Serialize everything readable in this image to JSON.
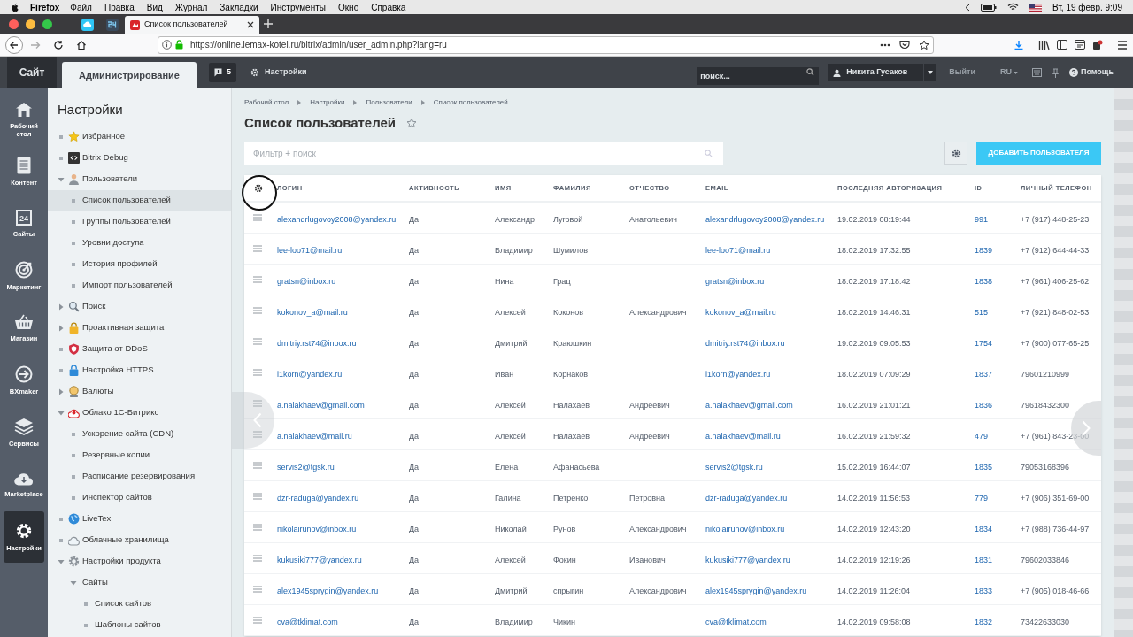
{
  "menubar": {
    "app": "Firefox",
    "menus": [
      "Файл",
      "Правка",
      "Вид",
      "Журнал",
      "Закладки",
      "Инструменты",
      "Окно",
      "Справка"
    ],
    "clock": "Вт, 19 февр. 9:09"
  },
  "browser": {
    "tabs": [
      {
        "kind": "pinned",
        "selected": false
      },
      {
        "kind": "pinned",
        "selected": false
      },
      {
        "kind": "page",
        "title": "Список пользователей",
        "selected": true
      }
    ],
    "url": "https://online.lemax-kotel.ru/bitrix/admin/user_admin.php?lang=ru"
  },
  "admin_bar": {
    "site_button": "Сайт",
    "admin_tab": "Администрирование",
    "notifications": "5",
    "settings": "Настройки",
    "search": {
      "placeholder": "поиск..."
    },
    "user": "Никита Гусаков",
    "logout": "Выйти",
    "language": "RU",
    "help": "Помощь"
  },
  "nav": [
    {
      "label": "Рабочий стол",
      "selected": false
    },
    {
      "label": "Контент",
      "selected": false
    },
    {
      "label": "Сайты",
      "icon_text": "24",
      "selected": false
    },
    {
      "label": "Маркетинг",
      "selected": false
    },
    {
      "label": "Магазин",
      "selected": false
    },
    {
      "label": "BXmaker",
      "selected": false
    },
    {
      "label": "Сервисы",
      "selected": false
    },
    {
      "label": "Marketplace",
      "selected": false
    },
    {
      "label": "Настройки",
      "selected": true
    }
  ],
  "sidebar": {
    "title": "Настройки",
    "items": [
      {
        "label": "Избранное",
        "kind": "leaf",
        "selected": false
      },
      {
        "label": "Bitrix Debug",
        "kind": "leaf",
        "selected": false
      },
      {
        "label": "Пользователи",
        "kind": "folder",
        "expanded": true,
        "selected": false,
        "children": [
          {
            "label": "Список пользователей",
            "kind": "leaf",
            "selected": true
          },
          {
            "label": "Группы пользователей",
            "kind": "leaf",
            "selected": false
          },
          {
            "label": "Уровни доступа",
            "kind": "leaf",
            "selected": false
          },
          {
            "label": "История профилей",
            "kind": "leaf",
            "selected": false
          },
          {
            "label": "Импорт пользователей",
            "kind": "leaf",
            "selected": false
          }
        ]
      },
      {
        "label": "Поиск",
        "kind": "folder",
        "expanded": false,
        "selected": false
      },
      {
        "label": "Проактивная защита",
        "kind": "folder",
        "expanded": false,
        "selected": false
      },
      {
        "label": "Защита от DDoS",
        "kind": "leaf",
        "selected": false
      },
      {
        "label": "Настройка HTTPS",
        "kind": "leaf",
        "selected": false
      },
      {
        "label": "Валюты",
        "kind": "folder",
        "expanded": false,
        "selected": false
      },
      {
        "label": "Облако 1С-Битрикс",
        "kind": "folder",
        "expanded": true,
        "selected": false,
        "children": [
          {
            "label": "Ускорение сайта (CDN)",
            "kind": "leaf",
            "selected": false
          },
          {
            "label": "Резервные копии",
            "kind": "leaf",
            "selected": false
          },
          {
            "label": "Расписание резервирования",
            "kind": "leaf",
            "selected": false
          },
          {
            "label": "Инспектор сайтов",
            "kind": "leaf",
            "selected": false
          }
        ]
      },
      {
        "label": "LiveTex",
        "kind": "leaf",
        "selected": false
      },
      {
        "label": "Облачные хранилища",
        "kind": "leaf",
        "selected": false
      },
      {
        "label": "Настройки продукта",
        "kind": "folder",
        "expanded": true,
        "selected": false,
        "children": [
          {
            "label": "Сайты",
            "kind": "folder",
            "expanded": true,
            "selected": false,
            "children": [
              {
                "label": "Список сайтов",
                "kind": "leaf",
                "selected": false
              },
              {
                "label": "Шаблоны сайтов",
                "kind": "leaf",
                "selected": false
              }
            ]
          }
        ]
      }
    ]
  },
  "page": {
    "breadcrumbs": [
      "Рабочий стол",
      "Настройки",
      "Пользователи",
      "Список пользователей"
    ],
    "title": "Список пользователей",
    "filter": {
      "placeholder": "Фильтр + поиск"
    },
    "add_button": "ДОБАВИТЬ ПОЛЬЗОВАТЕЛЯ"
  },
  "table": {
    "columns": [
      "ЛОГИН",
      "АКТИВНОСТЬ",
      "ИМЯ",
      "ФАМИЛИЯ",
      "ОТЧЕСТВО",
      "EMAIL",
      "ПОСЛЕДНЯЯ АВТОРИЗАЦИЯ",
      "ID",
      "ЛИЧНЫЙ ТЕЛЕФОН"
    ],
    "rows": [
      {
        "login": "alexandrlugovoy2008@yandex.ru",
        "active": "Да",
        "first_name": "Александр",
        "last_name": "Луговой",
        "middle_name": "Анатольевич",
        "email": "alexandrlugovoy2008@yandex.ru",
        "last_login": "19.02.2019 08:19:44",
        "id": "991",
        "phone": "+7 (917) 448-25-23"
      },
      {
        "login": "lee-loo71@mail.ru",
        "active": "Да",
        "first_name": "Владимир",
        "last_name": "Шумилов",
        "email": "lee-loo71@mail.ru",
        "last_login": "18.02.2019 17:32:55",
        "id": "1839",
        "phone": "+7 (912) 644-44-33"
      },
      {
        "login": "gratsn@inbox.ru",
        "active": "Да",
        "first_name": "Нина",
        "last_name": "Грац",
        "email": "gratsn@inbox.ru",
        "last_login": "18.02.2019 17:18:42",
        "id": "1838",
        "phone": "+7 (961) 406-25-62"
      },
      {
        "login": "kokonov_a@mail.ru",
        "active": "Да",
        "first_name": "Алексей",
        "last_name": "Коконов",
        "middle_name": "Александрович",
        "email": "kokonov_a@mail.ru",
        "last_login": "18.02.2019 14:46:31",
        "id": "515",
        "phone": "+7 (921) 848-02-53"
      },
      {
        "login": "dmitriy.rst74@inbox.ru",
        "active": "Да",
        "first_name": "Дмитрий",
        "last_name": "Краюшкин",
        "email": "dmitriy.rst74@inbox.ru",
        "last_login": "19.02.2019 09:05:53",
        "id": "1754",
        "phone": "+7 (900) 077-65-25"
      },
      {
        "login": "i1korn@yandex.ru",
        "active": "Да",
        "first_name": "Иван",
        "last_name": "Корнаков",
        "email": "i1korn@yandex.ru",
        "last_login": "18.02.2019 07:09:29",
        "id": "1837",
        "phone": "79601210999"
      },
      {
        "login": "a.nalakhaev@gmail.com",
        "active": "Да",
        "first_name": "Алексей",
        "last_name": "Налахаев",
        "middle_name": "Андреевич",
        "email": "a.nalakhaev@gmail.com",
        "last_login": "16.02.2019 21:01:21",
        "id": "1836",
        "phone": "79618432300"
      },
      {
        "login": "a.nalakhaev@mail.ru",
        "active": "Да",
        "first_name": "Алексей",
        "last_name": "Налахаев",
        "middle_name": "Андреевич",
        "email": "a.nalakhaev@mail.ru",
        "last_login": "16.02.2019 21:59:32",
        "id": "479",
        "phone": "+7 (961) 843-23-00"
      },
      {
        "login": "servis2@tgsk.ru",
        "active": "Да",
        "first_name": "Елена",
        "last_name": "Афанасьева",
        "email": "servis2@tgsk.ru",
        "last_login": "15.02.2019 16:44:07",
        "id": "1835",
        "phone": "79053168396"
      },
      {
        "login": "dzr-raduga@yandex.ru",
        "active": "Да",
        "first_name": "Галина",
        "last_name": "Петренко",
        "middle_name": "Петровна",
        "email": "dzr-raduga@yandex.ru",
        "last_login": "14.02.2019 11:56:53",
        "id": "779",
        "phone": "+7 (906) 351-69-00"
      },
      {
        "login": "nikolairunov@inbox.ru",
        "active": "Да",
        "first_name": "Николай",
        "last_name": "Рунов",
        "middle_name": "Александрович",
        "email": "nikolairunov@inbox.ru",
        "last_login": "14.02.2019 12:43:20",
        "id": "1834",
        "phone": "+7 (988) 736-44-97"
      },
      {
        "login": "kukusiki777@yandex.ru",
        "active": "Да",
        "first_name": "Алексей",
        "last_name": "Фокин",
        "middle_name": "Иванович",
        "email": "kukusiki777@yandex.ru",
        "last_login": "14.02.2019 12:19:26",
        "id": "1831",
        "phone": "79602033846"
      },
      {
        "login": "alex1945sprygin@yandex.ru",
        "active": "Да",
        "first_name": "Дмитрий",
        "last_name": "спрыгин",
        "middle_name": "Александрович",
        "email": "alex1945sprygin@yandex.ru",
        "last_login": "14.02.2019 11:26:04",
        "id": "1833",
        "phone": "+7 (905) 018-46-66"
      },
      {
        "login": "cva@tklimat.com",
        "active": "Да",
        "first_name": "Владимир",
        "last_name": "Чикин",
        "email": "cva@tklimat.com",
        "last_login": "14.02.2019 09:58:08",
        "id": "1832",
        "phone": "73422633030"
      }
    ]
  }
}
